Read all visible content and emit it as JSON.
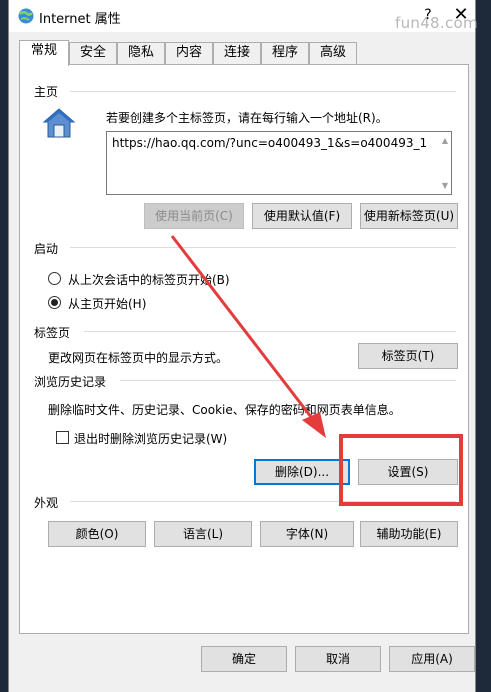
{
  "window": {
    "title": "Internet 属性",
    "help": "?",
    "close": "✕",
    "watermark": "fun48.com"
  },
  "tabs": [
    {
      "label": "常规",
      "active": true
    },
    {
      "label": "安全"
    },
    {
      "label": "隐私"
    },
    {
      "label": "内容"
    },
    {
      "label": "连接"
    },
    {
      "label": "程序"
    },
    {
      "label": "高级"
    }
  ],
  "homepage": {
    "section": "主页",
    "description": "若要创建多个主标签页，请在每行输入一个地址(R)。",
    "url": "https://hao.qq.com/?unc=o400493_1&s=o400493_1",
    "use_current": "使用当前页(C)",
    "use_default": "使用默认值(F)",
    "use_new_tab": "使用新标签页(U)"
  },
  "startup": {
    "section": "启动",
    "option_last_session": "从上次会话中的标签页开始(B)",
    "option_homepage": "从主页开始(H)"
  },
  "tabs_section": {
    "section": "标签页",
    "description": "更改网页在标签页中的显示方式。",
    "button": "标签页(T)"
  },
  "history": {
    "section": "浏览历史记录",
    "description": "删除临时文件、历史记录、Cookie、保存的密码和网页表单信息。",
    "delete_on_exit": "退出时删除浏览历史记录(W)",
    "delete_button": "删除(D)...",
    "settings_button": "设置(S)"
  },
  "appearance": {
    "section": "外观",
    "colors": "颜色(O)",
    "languages": "语言(L)",
    "fonts": "字体(N)",
    "accessibility": "辅助功能(E)"
  },
  "footer": {
    "ok": "确定",
    "cancel": "取消",
    "apply": "应用(A)"
  },
  "colors": {
    "accent": "#0078d7",
    "annotation": "#e43c3c"
  }
}
